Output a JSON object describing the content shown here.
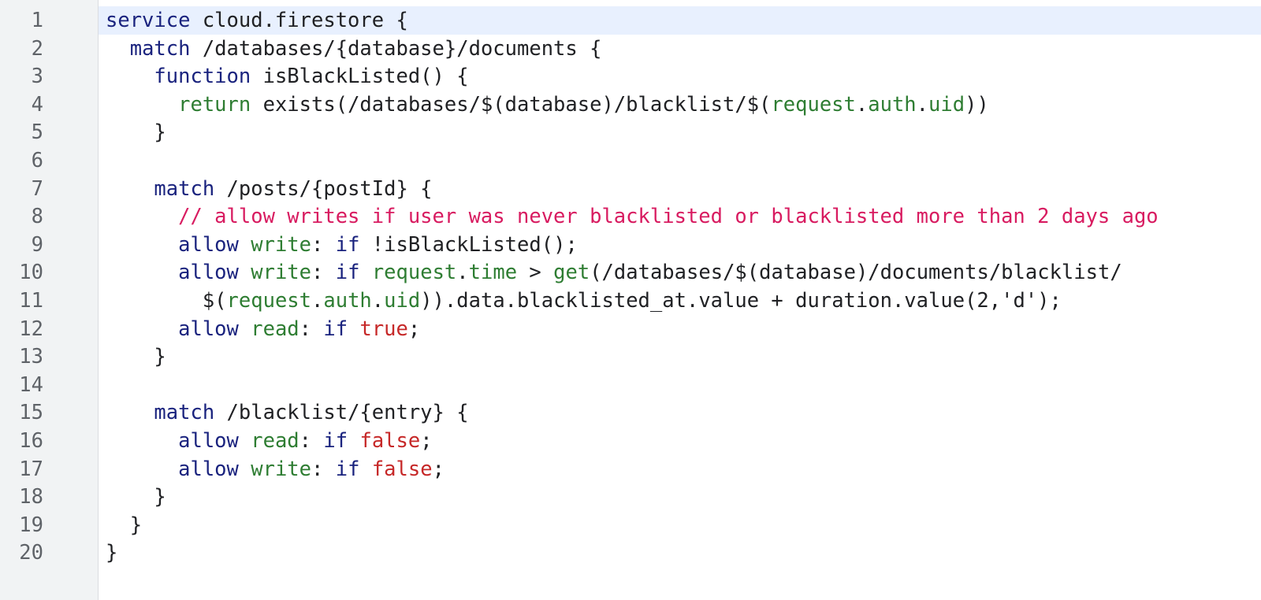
{
  "colors": {
    "keyword": "#1a237e",
    "builtin": "#2e7d32",
    "literal": "#c62828",
    "comment": "#d81b60",
    "plain": "#202124",
    "gutter_bg": "#f1f3f4",
    "active_line_bg": "#e8f0fe"
  },
  "editor": {
    "active_line": 1,
    "lines": [
      {
        "number": "1",
        "indent": "",
        "tokens": [
          {
            "t": "kw",
            "v": "service"
          },
          {
            "t": "plain",
            "v": " cloud.firestore {"
          }
        ]
      },
      {
        "number": "2",
        "indent": "  ",
        "tokens": [
          {
            "t": "kw",
            "v": "match"
          },
          {
            "t": "plain",
            "v": " /databases/{database}/documents {"
          }
        ]
      },
      {
        "number": "3",
        "indent": "    ",
        "tokens": [
          {
            "t": "kw",
            "v": "function"
          },
          {
            "t": "plain",
            "v": " isBlackListed() {"
          }
        ]
      },
      {
        "number": "4",
        "indent": "      ",
        "tokens": [
          {
            "t": "fn",
            "v": "return"
          },
          {
            "t": "plain",
            "v": " exists(/databases/$(database)/blacklist/$("
          },
          {
            "t": "fn",
            "v": "request"
          },
          {
            "t": "plain",
            "v": "."
          },
          {
            "t": "fn",
            "v": "auth"
          },
          {
            "t": "plain",
            "v": "."
          },
          {
            "t": "fn",
            "v": "uid"
          },
          {
            "t": "plain",
            "v": "))"
          }
        ]
      },
      {
        "number": "5",
        "indent": "    ",
        "tokens": [
          {
            "t": "plain",
            "v": "}"
          }
        ]
      },
      {
        "number": "6",
        "indent": "",
        "tokens": []
      },
      {
        "number": "7",
        "indent": "    ",
        "tokens": [
          {
            "t": "kw",
            "v": "match"
          },
          {
            "t": "plain",
            "v": " /posts/{postId} {"
          }
        ]
      },
      {
        "number": "8",
        "indent": "      ",
        "tokens": [
          {
            "t": "cmt",
            "v": "// allow writes if user was never blacklisted or blacklisted more than 2 days ago"
          }
        ]
      },
      {
        "number": "9",
        "indent": "      ",
        "tokens": [
          {
            "t": "kw",
            "v": "allow"
          },
          {
            "t": "plain",
            "v": " "
          },
          {
            "t": "fn",
            "v": "write"
          },
          {
            "t": "plain",
            "v": ": "
          },
          {
            "t": "kw",
            "v": "if"
          },
          {
            "t": "plain",
            "v": " !isBlackListed();"
          }
        ]
      },
      {
        "number": "10",
        "indent": "      ",
        "tokens": [
          {
            "t": "kw",
            "v": "allow"
          },
          {
            "t": "plain",
            "v": " "
          },
          {
            "t": "fn",
            "v": "write"
          },
          {
            "t": "plain",
            "v": ": "
          },
          {
            "t": "kw",
            "v": "if"
          },
          {
            "t": "plain",
            "v": " "
          },
          {
            "t": "fn",
            "v": "request"
          },
          {
            "t": "plain",
            "v": "."
          },
          {
            "t": "fn",
            "v": "time"
          },
          {
            "t": "plain",
            "v": " > "
          },
          {
            "t": "fn",
            "v": "get"
          },
          {
            "t": "plain",
            "v": "(/databases/$(database)/documents/blacklist/"
          }
        ]
      },
      {
        "number": "11",
        "indent": "        ",
        "tokens": [
          {
            "t": "plain",
            "v": "$("
          },
          {
            "t": "fn",
            "v": "request"
          },
          {
            "t": "plain",
            "v": "."
          },
          {
            "t": "fn",
            "v": "auth"
          },
          {
            "t": "plain",
            "v": "."
          },
          {
            "t": "fn",
            "v": "uid"
          },
          {
            "t": "plain",
            "v": ")).data.blacklisted_at.value + duration.value(2,'d');"
          }
        ]
      },
      {
        "number": "12",
        "indent": "      ",
        "tokens": [
          {
            "t": "kw",
            "v": "allow"
          },
          {
            "t": "plain",
            "v": " "
          },
          {
            "t": "fn",
            "v": "read"
          },
          {
            "t": "plain",
            "v": ": "
          },
          {
            "t": "kw",
            "v": "if"
          },
          {
            "t": "plain",
            "v": " "
          },
          {
            "t": "lit",
            "v": "true"
          },
          {
            "t": "plain",
            "v": ";"
          }
        ]
      },
      {
        "number": "13",
        "indent": "    ",
        "tokens": [
          {
            "t": "plain",
            "v": "}"
          }
        ]
      },
      {
        "number": "14",
        "indent": "",
        "tokens": []
      },
      {
        "number": "15",
        "indent": "    ",
        "tokens": [
          {
            "t": "kw",
            "v": "match"
          },
          {
            "t": "plain",
            "v": " /blacklist/{entry} {"
          }
        ]
      },
      {
        "number": "16",
        "indent": "      ",
        "tokens": [
          {
            "t": "kw",
            "v": "allow"
          },
          {
            "t": "plain",
            "v": " "
          },
          {
            "t": "fn",
            "v": "read"
          },
          {
            "t": "plain",
            "v": ": "
          },
          {
            "t": "kw",
            "v": "if"
          },
          {
            "t": "plain",
            "v": " "
          },
          {
            "t": "lit",
            "v": "false"
          },
          {
            "t": "plain",
            "v": ";"
          }
        ]
      },
      {
        "number": "17",
        "indent": "      ",
        "tokens": [
          {
            "t": "kw",
            "v": "allow"
          },
          {
            "t": "plain",
            "v": " "
          },
          {
            "t": "fn",
            "v": "write"
          },
          {
            "t": "plain",
            "v": ": "
          },
          {
            "t": "kw",
            "v": "if"
          },
          {
            "t": "plain",
            "v": " "
          },
          {
            "t": "lit",
            "v": "false"
          },
          {
            "t": "plain",
            "v": ";"
          }
        ]
      },
      {
        "number": "18",
        "indent": "    ",
        "tokens": [
          {
            "t": "plain",
            "v": "}"
          }
        ]
      },
      {
        "number": "19",
        "indent": "  ",
        "tokens": [
          {
            "t": "plain",
            "v": "}"
          }
        ]
      },
      {
        "number": "20",
        "indent": "",
        "tokens": [
          {
            "t": "plain",
            "v": "}"
          }
        ]
      }
    ]
  }
}
